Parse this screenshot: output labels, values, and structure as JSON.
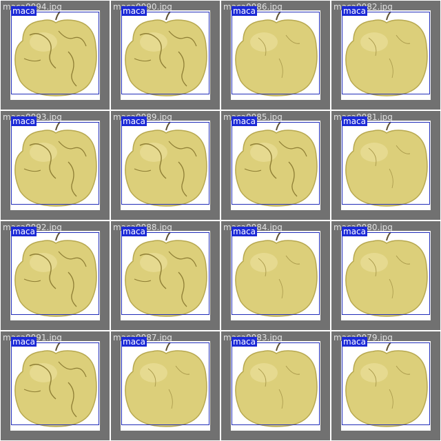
{
  "tiles": [
    {
      "filename": "maca0094.jpg",
      "label": "maca",
      "variant": "a"
    },
    {
      "filename": "maca0090.jpg",
      "label": "maca",
      "variant": "a"
    },
    {
      "filename": "maca0086.jpg",
      "label": "maca",
      "variant": "b"
    },
    {
      "filename": "maca0082.jpg",
      "label": "maca",
      "variant": "b"
    },
    {
      "filename": "maca0093.jpg",
      "label": "maca",
      "variant": "a"
    },
    {
      "filename": "maca0089.jpg",
      "label": "maca",
      "variant": "a"
    },
    {
      "filename": "maca0085.jpg",
      "label": "maca",
      "variant": "a"
    },
    {
      "filename": "maca0081.jpg",
      "label": "maca",
      "variant": "b"
    },
    {
      "filename": "maca0092.jpg",
      "label": "maca",
      "variant": "a"
    },
    {
      "filename": "maca0088.jpg",
      "label": "maca",
      "variant": "a"
    },
    {
      "filename": "maca0084.jpg",
      "label": "maca",
      "variant": "b"
    },
    {
      "filename": "maca0080.jpg",
      "label": "maca",
      "variant": "b"
    },
    {
      "filename": "maca0091.jpg",
      "label": "maca",
      "variant": "a"
    },
    {
      "filename": "maca0087.jpg",
      "label": "maca",
      "variant": "b"
    },
    {
      "filename": "maca0083.jpg",
      "label": "maca",
      "variant": "b"
    },
    {
      "filename": "maca0079.jpg",
      "label": "maca",
      "variant": "b"
    }
  ],
  "colors": {
    "tile_background": "#717171",
    "box_border": "#1e2ab8",
    "label_background": "#1c2ad6",
    "apple_fill": "#dccf7a",
    "apple_shadow": "#b7a84f"
  }
}
